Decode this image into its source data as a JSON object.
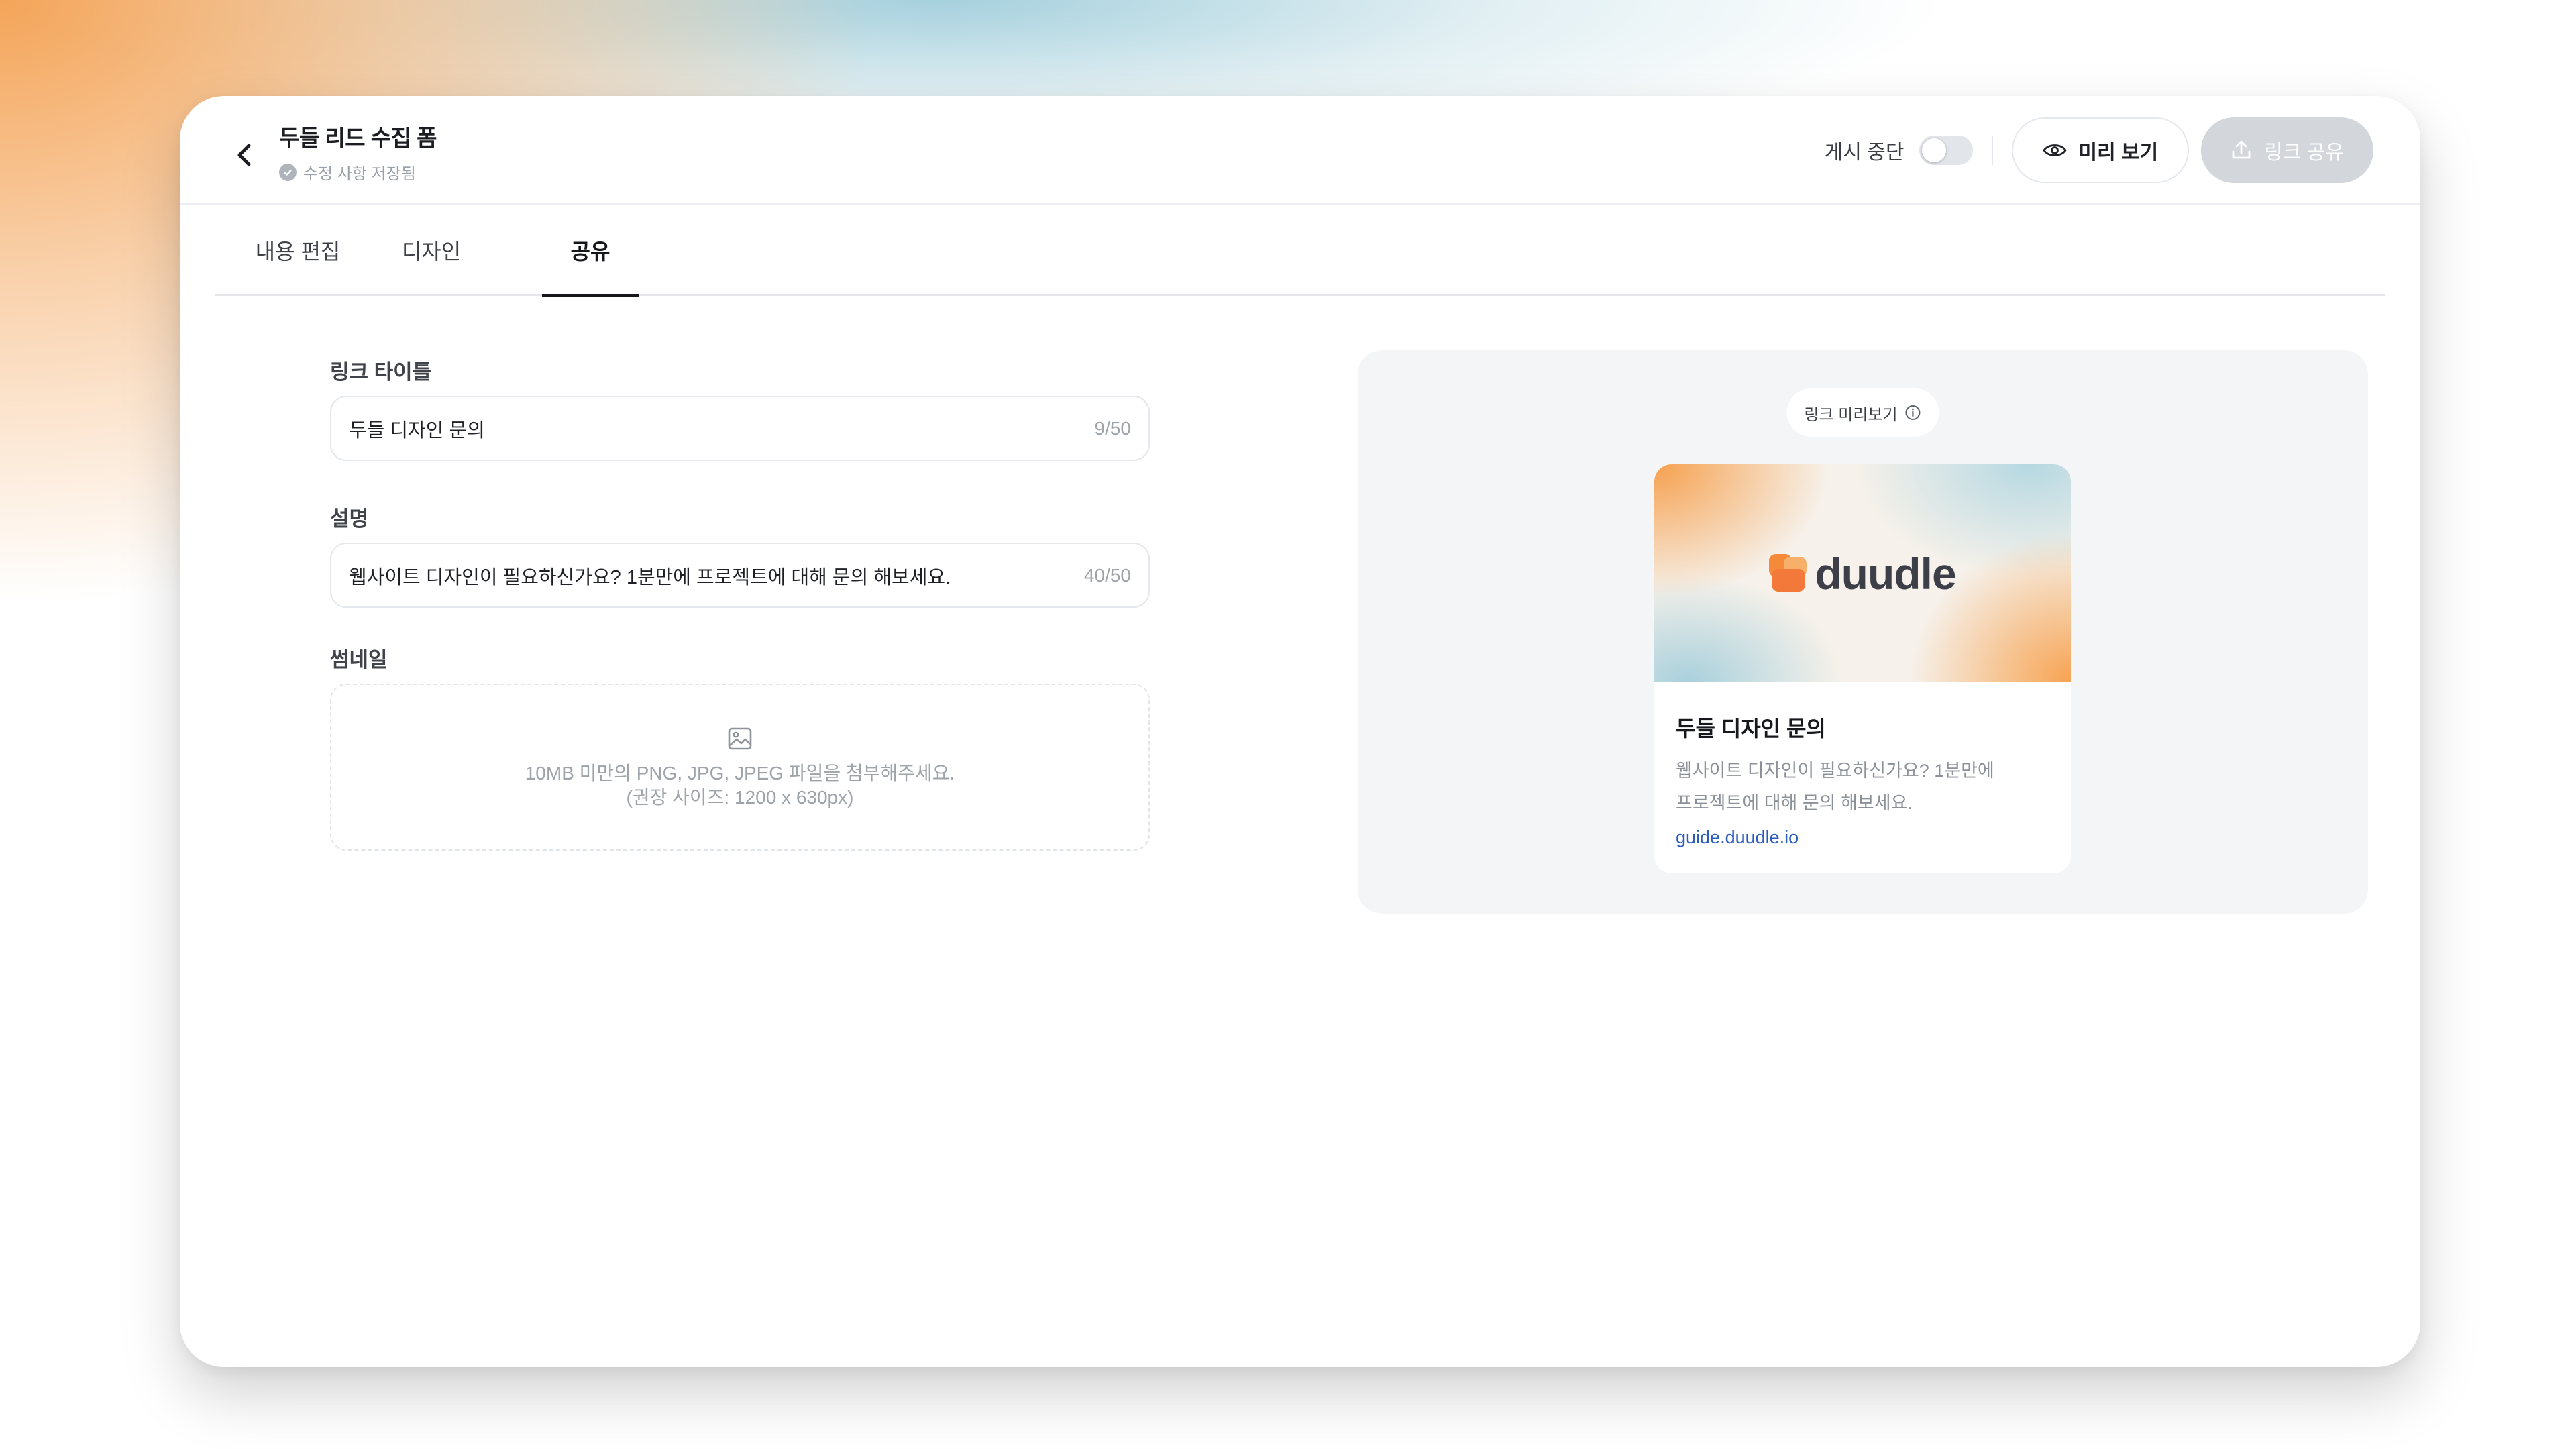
{
  "header": {
    "title": "두들 리드 수집 폼",
    "save_status": "수정 사항 저장됨",
    "publish_toggle_label": "게시 중단",
    "preview_label": "미리 보기",
    "share_label": "링크 공유"
  },
  "tabs": [
    {
      "label": "내용 편집"
    },
    {
      "label": "디자인"
    },
    {
      "label": "공유",
      "active": true
    }
  ],
  "form": {
    "link_title": {
      "label": "링크 타이틀",
      "value": "두들 디자인 문의",
      "counter": "9/50"
    },
    "description": {
      "label": "설명",
      "value": "웹사이트 디자인이 필요하신가요? 1분만에 프로젝트에 대해 문의 해보세요.",
      "counter": "40/50"
    },
    "thumbnail": {
      "label": "썸네일",
      "hint_line1": "10MB 미만의 PNG, JPG, JPEG 파일을 첨부해주세요.",
      "hint_line2": "(권장 사이즈: 1200 x 630px)"
    }
  },
  "preview": {
    "pill_label": "링크 미리보기",
    "card": {
      "logo_text": "duudle",
      "title": "두들 디자인 문의",
      "desc_line1": "웹사이트 디자인이 필요하신가요? 1분만에",
      "desc_line2": "프로젝트에 대해 문의 해보세요.",
      "url": "guide.duudle.io"
    }
  },
  "colors": {
    "accent_orange": "#f6a04e",
    "accent_blue": "#a9d0dc",
    "link_blue": "#2a5bbf",
    "disabled_button": "#d3d6da"
  }
}
